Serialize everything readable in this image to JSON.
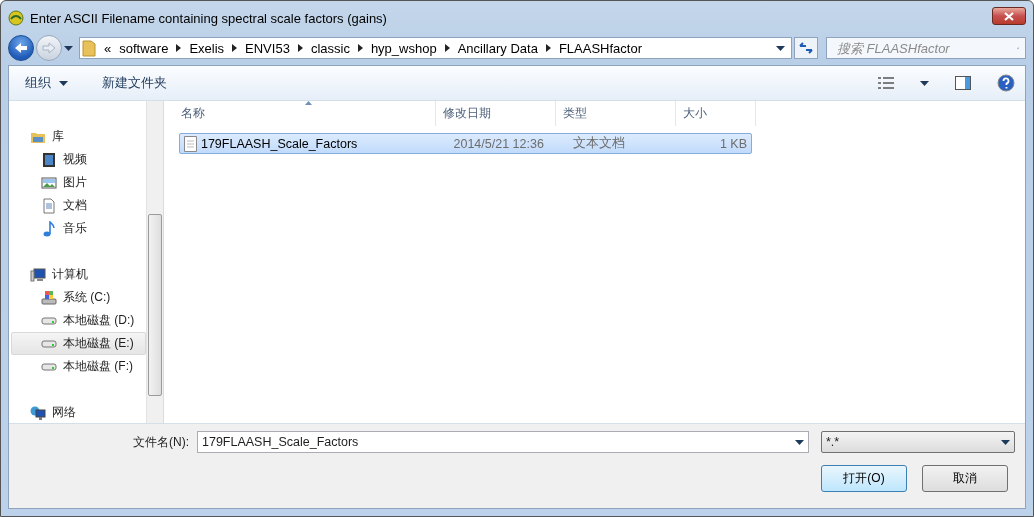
{
  "window": {
    "title": "Enter ASCII Filename containing spectral scale factors (gains)"
  },
  "address": {
    "overflow": "«",
    "segments": [
      "software",
      "Exelis",
      "ENVI53",
      "classic",
      "hyp_wshop",
      "Ancillary Data",
      "FLAASHfactor"
    ]
  },
  "search": {
    "placeholder": "搜索 FLAASHfactor"
  },
  "toolbar": {
    "organize": "组织",
    "new_folder": "新建文件夹"
  },
  "sidebar": [
    {
      "label": "库",
      "kind": "library",
      "selected": false,
      "children": [
        {
          "label": "视频",
          "kind": "video",
          "selected": false
        },
        {
          "label": "图片",
          "kind": "pictures",
          "selected": false
        },
        {
          "label": "文档",
          "kind": "documents",
          "selected": false
        },
        {
          "label": "音乐",
          "kind": "music",
          "selected": false
        }
      ]
    },
    {
      "label": "计算机",
      "kind": "computer",
      "selected": false,
      "children": [
        {
          "label": "系统 (C:)",
          "kind": "system-drive",
          "selected": false
        },
        {
          "label": "本地磁盘 (D:)",
          "kind": "drive",
          "selected": false
        },
        {
          "label": "本地磁盘 (E:)",
          "kind": "drive",
          "selected": true
        },
        {
          "label": "本地磁盘 (F:)",
          "kind": "drive",
          "selected": false
        }
      ]
    },
    {
      "label": "网络",
      "kind": "network",
      "selected": false
    }
  ],
  "columns": [
    {
      "label": "名称",
      "sorted": true
    },
    {
      "label": "修改日期",
      "sorted": false
    },
    {
      "label": "类型",
      "sorted": false
    },
    {
      "label": "大小",
      "sorted": false
    }
  ],
  "files": [
    {
      "name": "179FLAASH_Scale_Factors",
      "modified": "2014/5/21 12:36",
      "type": "文本文档",
      "size": "1 KB",
      "selected": true
    }
  ],
  "filename": {
    "label": "文件名(N):",
    "value": "179FLAASH_Scale_Factors"
  },
  "filter": {
    "value": "*.*"
  },
  "buttons": [
    {
      "label": "打开(O)",
      "default": true
    },
    {
      "label": "取消",
      "default": false
    }
  ]
}
